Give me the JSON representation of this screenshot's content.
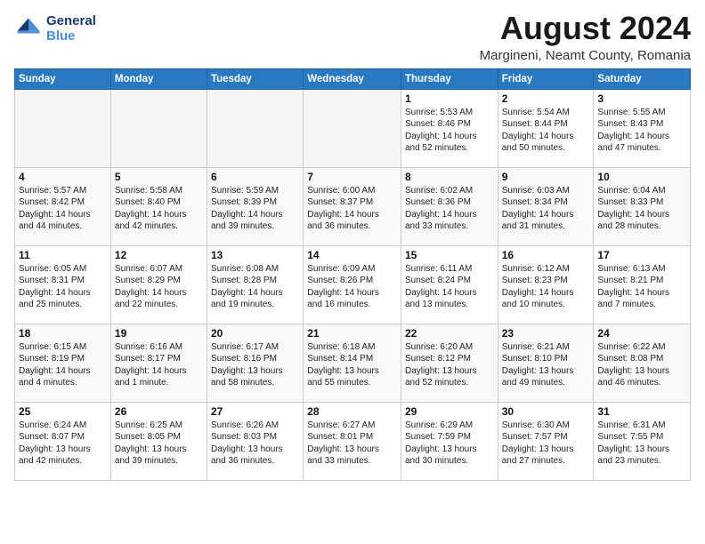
{
  "logo": {
    "general": "General",
    "blue": "Blue"
  },
  "title": "August 2024",
  "subtitle": "Margineni, Neamt County, Romania",
  "days_of_week": [
    "Sunday",
    "Monday",
    "Tuesday",
    "Wednesday",
    "Thursday",
    "Friday",
    "Saturday"
  ],
  "weeks": [
    [
      {
        "day": "",
        "info": ""
      },
      {
        "day": "",
        "info": ""
      },
      {
        "day": "",
        "info": ""
      },
      {
        "day": "",
        "info": ""
      },
      {
        "day": "1",
        "info": "Sunrise: 5:53 AM\nSunset: 8:46 PM\nDaylight: 14 hours\nand 52 minutes."
      },
      {
        "day": "2",
        "info": "Sunrise: 5:54 AM\nSunset: 8:44 PM\nDaylight: 14 hours\nand 50 minutes."
      },
      {
        "day": "3",
        "info": "Sunrise: 5:55 AM\nSunset: 8:43 PM\nDaylight: 14 hours\nand 47 minutes."
      }
    ],
    [
      {
        "day": "4",
        "info": "Sunrise: 5:57 AM\nSunset: 8:42 PM\nDaylight: 14 hours\nand 44 minutes."
      },
      {
        "day": "5",
        "info": "Sunrise: 5:58 AM\nSunset: 8:40 PM\nDaylight: 14 hours\nand 42 minutes."
      },
      {
        "day": "6",
        "info": "Sunrise: 5:59 AM\nSunset: 8:39 PM\nDaylight: 14 hours\nand 39 minutes."
      },
      {
        "day": "7",
        "info": "Sunrise: 6:00 AM\nSunset: 8:37 PM\nDaylight: 14 hours\nand 36 minutes."
      },
      {
        "day": "8",
        "info": "Sunrise: 6:02 AM\nSunset: 8:36 PM\nDaylight: 14 hours\nand 33 minutes."
      },
      {
        "day": "9",
        "info": "Sunrise: 6:03 AM\nSunset: 8:34 PM\nDaylight: 14 hours\nand 31 minutes."
      },
      {
        "day": "10",
        "info": "Sunrise: 6:04 AM\nSunset: 8:33 PM\nDaylight: 14 hours\nand 28 minutes."
      }
    ],
    [
      {
        "day": "11",
        "info": "Sunrise: 6:05 AM\nSunset: 8:31 PM\nDaylight: 14 hours\nand 25 minutes."
      },
      {
        "day": "12",
        "info": "Sunrise: 6:07 AM\nSunset: 8:29 PM\nDaylight: 14 hours\nand 22 minutes."
      },
      {
        "day": "13",
        "info": "Sunrise: 6:08 AM\nSunset: 8:28 PM\nDaylight: 14 hours\nand 19 minutes."
      },
      {
        "day": "14",
        "info": "Sunrise: 6:09 AM\nSunset: 8:26 PM\nDaylight: 14 hours\nand 16 minutes."
      },
      {
        "day": "15",
        "info": "Sunrise: 6:11 AM\nSunset: 8:24 PM\nDaylight: 14 hours\nand 13 minutes."
      },
      {
        "day": "16",
        "info": "Sunrise: 6:12 AM\nSunset: 8:23 PM\nDaylight: 14 hours\nand 10 minutes."
      },
      {
        "day": "17",
        "info": "Sunrise: 6:13 AM\nSunset: 8:21 PM\nDaylight: 14 hours\nand 7 minutes."
      }
    ],
    [
      {
        "day": "18",
        "info": "Sunrise: 6:15 AM\nSunset: 8:19 PM\nDaylight: 14 hours\nand 4 minutes."
      },
      {
        "day": "19",
        "info": "Sunrise: 6:16 AM\nSunset: 8:17 PM\nDaylight: 14 hours\nand 1 minute."
      },
      {
        "day": "20",
        "info": "Sunrise: 6:17 AM\nSunset: 8:16 PM\nDaylight: 13 hours\nand 58 minutes."
      },
      {
        "day": "21",
        "info": "Sunrise: 6:18 AM\nSunset: 8:14 PM\nDaylight: 13 hours\nand 55 minutes."
      },
      {
        "day": "22",
        "info": "Sunrise: 6:20 AM\nSunset: 8:12 PM\nDaylight: 13 hours\nand 52 minutes."
      },
      {
        "day": "23",
        "info": "Sunrise: 6:21 AM\nSunset: 8:10 PM\nDaylight: 13 hours\nand 49 minutes."
      },
      {
        "day": "24",
        "info": "Sunrise: 6:22 AM\nSunset: 8:08 PM\nDaylight: 13 hours\nand 46 minutes."
      }
    ],
    [
      {
        "day": "25",
        "info": "Sunrise: 6:24 AM\nSunset: 8:07 PM\nDaylight: 13 hours\nand 42 minutes."
      },
      {
        "day": "26",
        "info": "Sunrise: 6:25 AM\nSunset: 8:05 PM\nDaylight: 13 hours\nand 39 minutes."
      },
      {
        "day": "27",
        "info": "Sunrise: 6:26 AM\nSunset: 8:03 PM\nDaylight: 13 hours\nand 36 minutes."
      },
      {
        "day": "28",
        "info": "Sunrise: 6:27 AM\nSunset: 8:01 PM\nDaylight: 13 hours\nand 33 minutes."
      },
      {
        "day": "29",
        "info": "Sunrise: 6:29 AM\nSunset: 7:59 PM\nDaylight: 13 hours\nand 30 minutes."
      },
      {
        "day": "30",
        "info": "Sunrise: 6:30 AM\nSunset: 7:57 PM\nDaylight: 13 hours\nand 27 minutes."
      },
      {
        "day": "31",
        "info": "Sunrise: 6:31 AM\nSunset: 7:55 PM\nDaylight: 13 hours\nand 23 minutes."
      }
    ]
  ]
}
